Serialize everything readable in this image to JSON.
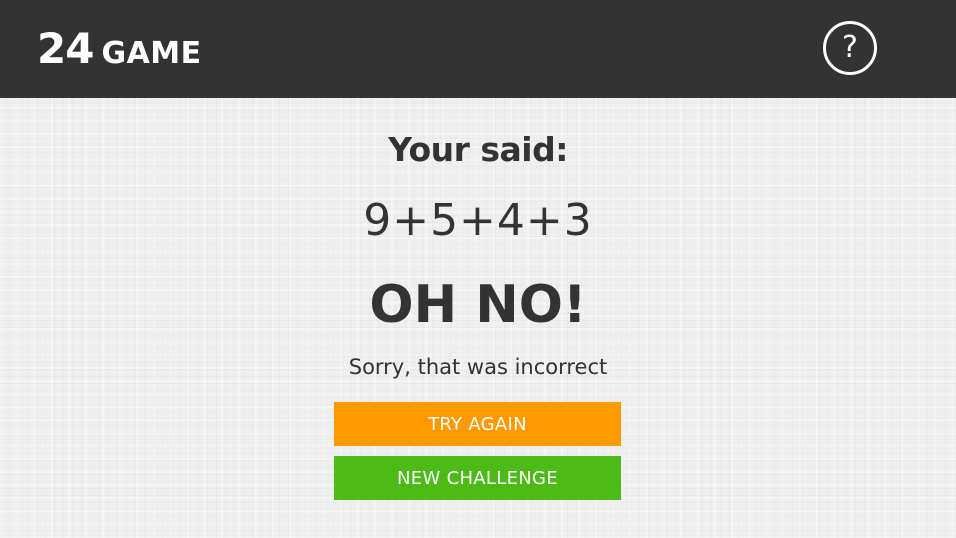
{
  "header": {
    "logo_number": "24",
    "logo_word": "GAME",
    "help_symbol": "?",
    "background_color": "#333333"
  },
  "result": {
    "said_label": "Your said:",
    "expression": "9+5+4+3",
    "title": "OH NO!",
    "message": "Sorry, that was incorrect"
  },
  "actions": {
    "try_again_label": "TRY AGAIN",
    "try_again_color": "#ff9900",
    "new_challenge_label": "NEW CHALLENGE",
    "new_challenge_color": "#4cbb17"
  },
  "icons": {
    "help": "question-circle-icon"
  }
}
